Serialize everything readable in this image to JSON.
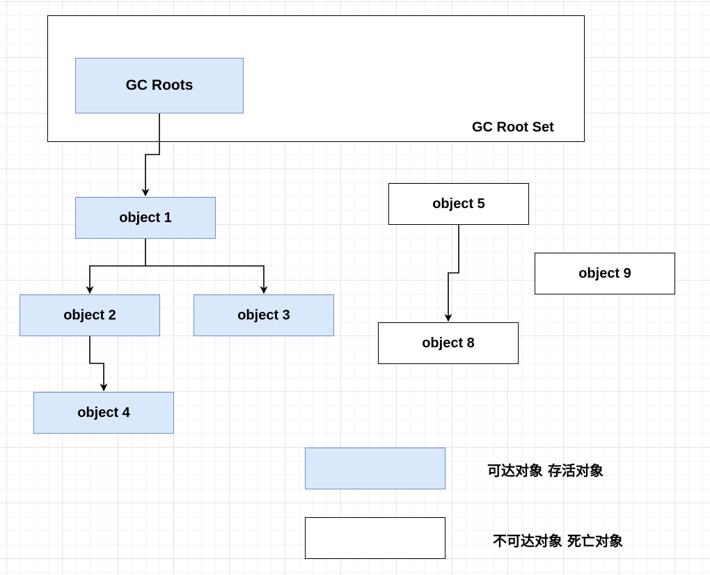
{
  "root_set": {
    "label": "GC Root Set"
  },
  "nodes": {
    "gc_roots": "GC Roots",
    "object_1": "object 1",
    "object_2": "object 2",
    "object_3": "object 3",
    "object_4": "object 4",
    "object_5": "object 5",
    "object_8": "object 8",
    "object_9": "object 9"
  },
  "legend": {
    "reachable": "可达对象 存活对象",
    "unreachable": "不可达对象 死亡对象"
  },
  "colors": {
    "reachable_fill": "#dae8fc",
    "reachable_stroke": "#6c8ebf",
    "unreachable_fill": "#ffffff",
    "unreachable_stroke": "#000000"
  }
}
